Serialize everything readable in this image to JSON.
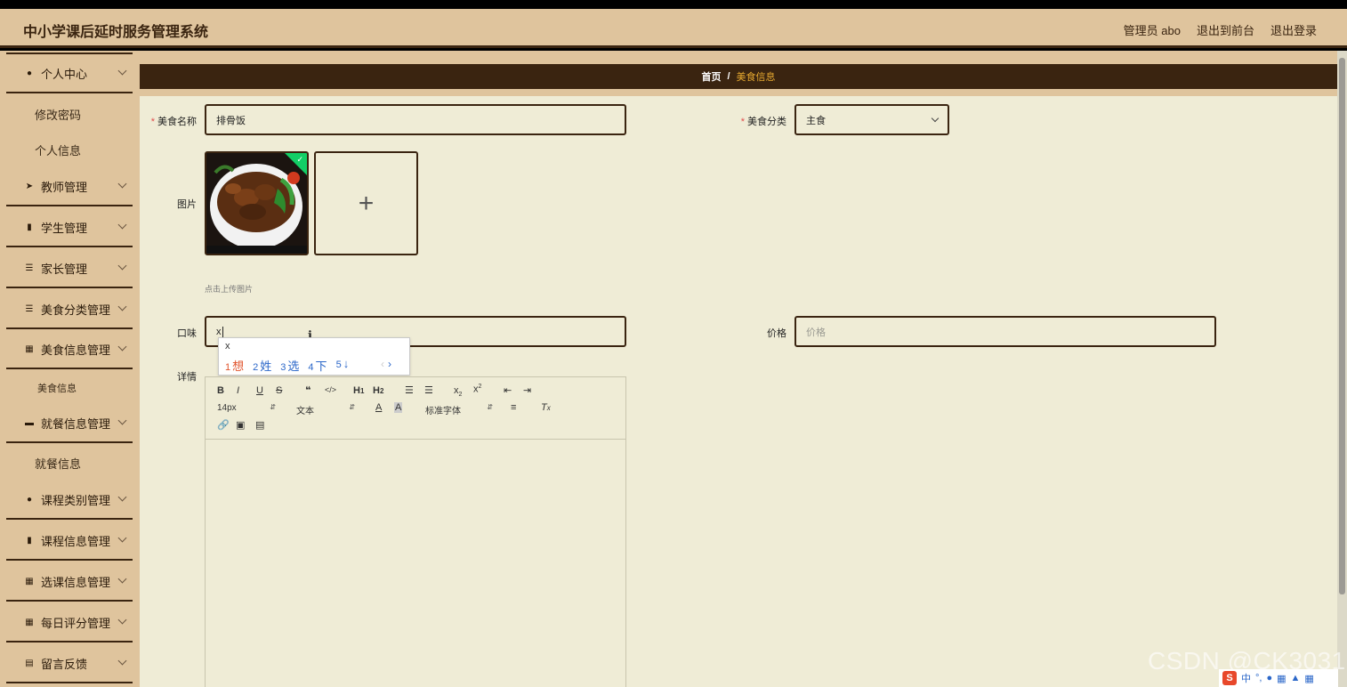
{
  "header": {
    "title": "中小学课后延时服务管理系统",
    "admin": "管理员 abo",
    "to_front": "退出到前台",
    "logout": "退出登录"
  },
  "sidebar": {
    "items": [
      {
        "label": "个人中心",
        "icon": "user-icon"
      },
      {
        "label": "修改密码"
      },
      {
        "label": "个人信息"
      },
      {
        "label": "教师管理",
        "icon": "send-icon"
      },
      {
        "label": "学生管理",
        "icon": "ticket-icon"
      },
      {
        "label": "家长管理",
        "icon": "sliders-icon"
      },
      {
        "label": "美食分类管理",
        "icon": "list-icon"
      },
      {
        "label": "美食信息管理",
        "icon": "grid-icon"
      },
      {
        "label": "美食信息"
      },
      {
        "label": "就餐信息管理",
        "icon": "monitor-icon"
      },
      {
        "label": "就餐信息"
      },
      {
        "label": "课程类别管理",
        "icon": "user-icon"
      },
      {
        "label": "课程信息管理",
        "icon": "print-icon"
      },
      {
        "label": "选课信息管理",
        "icon": "grid-icon"
      },
      {
        "label": "每日评分管理",
        "icon": "grid-icon"
      },
      {
        "label": "留言反馈",
        "icon": "note-icon"
      }
    ]
  },
  "breadcrumb": {
    "home": "首页",
    "separator": "/",
    "current": "美食信息"
  },
  "form": {
    "name_label": "美食名称",
    "name_value": "排骨饭",
    "category_label": "美食分类",
    "category_value": "主食",
    "image_label": "图片",
    "upload_hint": "点击上传图片",
    "taste_label": "口味",
    "taste_value": "x",
    "price_label": "价格",
    "price_placeholder": "价格",
    "detail_label": "详情",
    "required_mark": "*"
  },
  "ime": {
    "composition": "x",
    "candidates": [
      {
        "n": "1",
        "text": "想"
      },
      {
        "n": "2",
        "text": "姓"
      },
      {
        "n": "3",
        "text": "选"
      },
      {
        "n": "4",
        "text": "下"
      },
      {
        "n": "5",
        "text": "↓"
      }
    ]
  },
  "editor": {
    "font_size": "14px",
    "block_type": "文本",
    "font_family": "标准字体"
  },
  "watermark": "CSDN @CK3031",
  "tray": {
    "ime_mode": "中"
  },
  "colors": {
    "header_bg": "#dfc49d",
    "dark_brown": "#3a2410",
    "main_bg": "#efecd6",
    "accent": "#e6a930",
    "required": "#e24c4c"
  }
}
